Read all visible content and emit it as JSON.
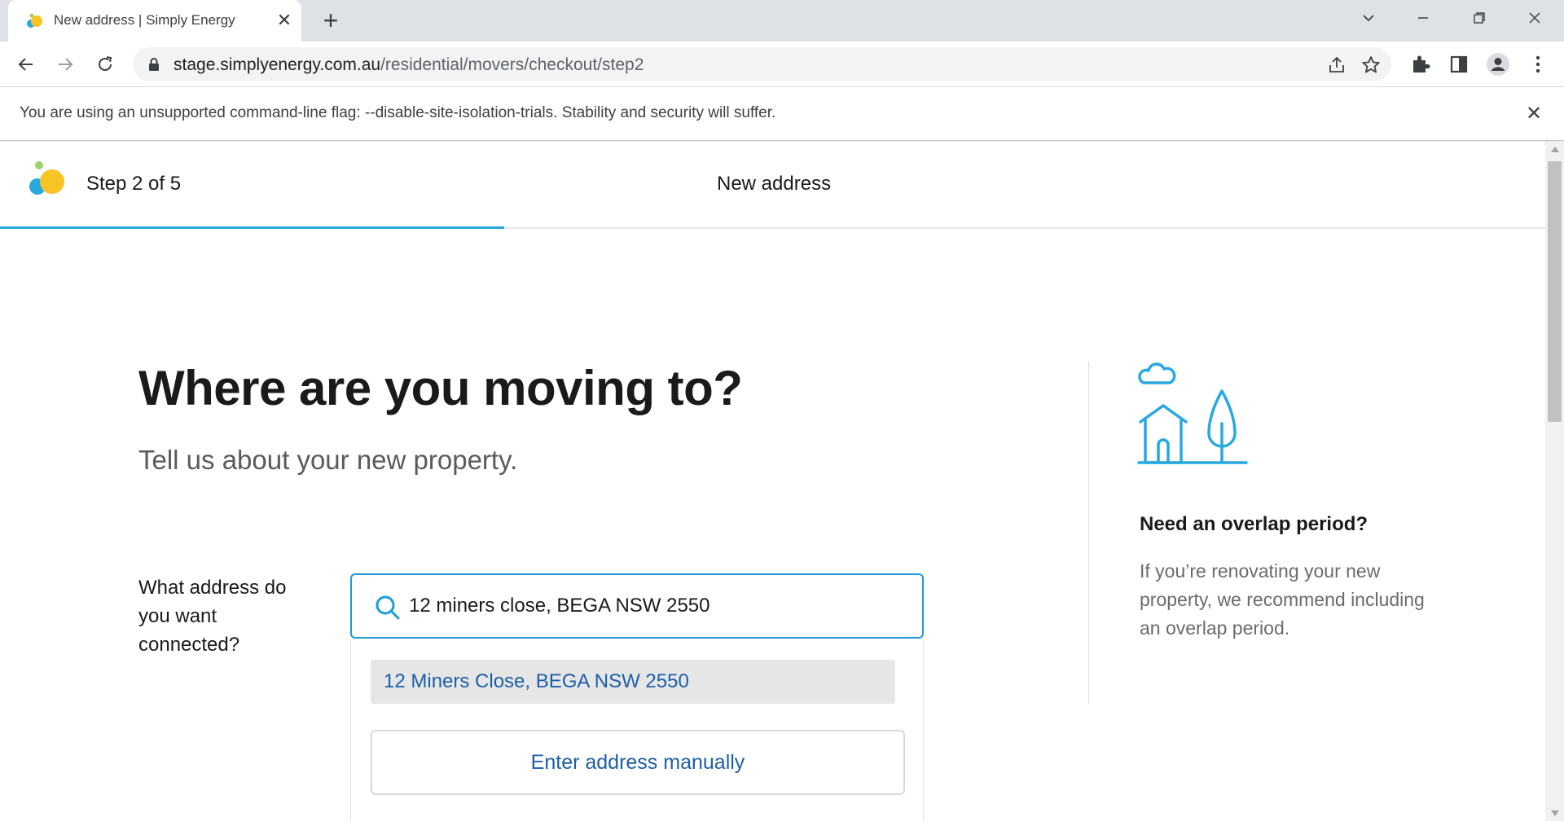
{
  "browser": {
    "tab_title": "New address | Simply Energy",
    "url_host": "stage.simplyenergy.com.au",
    "url_path": "/residential/movers/checkout/step2",
    "infobar_message": "You are using an unsupported command-line flag: --disable-site-isolation-trials. Stability and security will suffer."
  },
  "header": {
    "step_label": "Step 2 of 5",
    "page_label": "New address",
    "progress": {
      "current": 2,
      "total": 5
    },
    "accent_color": "#29a8e0"
  },
  "main": {
    "title": "Where are you moving to?",
    "subtitle": "Tell us about your new property.",
    "address_label": "What address do you want connected?",
    "address_value": "12 miners close, BEGA NSW 2550",
    "suggestions": [
      "12 Miners Close, BEGA NSW 2550"
    ],
    "manual_entry_label": "Enter address manually"
  },
  "aside": {
    "title": "Need an overlap period?",
    "text": "If you’re renovating your new property, we recommend including an overlap period."
  },
  "colors": {
    "link_blue": "#1d5fa6",
    "focus_border": "#1b9bd6",
    "icon_blue": "#29a8e0"
  }
}
